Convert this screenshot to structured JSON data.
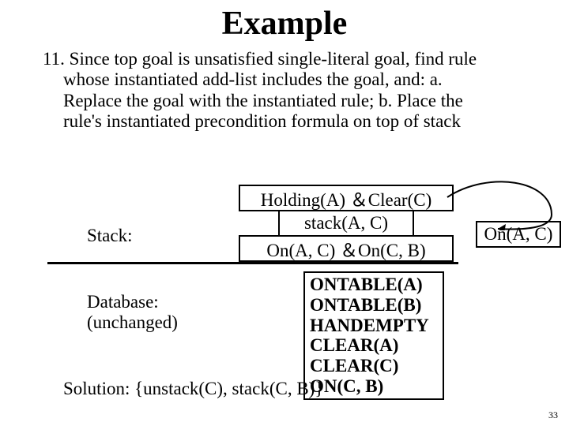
{
  "title": "Example",
  "body": "11. Since top goal is unsatisfied single-literal goal, find rule whose instantiated add-list includes the goal, and:  a. Replace the goal with the instantiated rule; b. Place the rule's instantiated precondition formula on top of stack",
  "stack": {
    "label": "Stack:",
    "top": "Holding(A) ＆Clear(C)",
    "mid": "stack(A, C)",
    "bot": "On(A, C) ＆On(C, B)"
  },
  "side_box": "On(A, C)",
  "database": {
    "label_line1": "Database:",
    "label_line2": "(unchanged)",
    "items": [
      "ONTABLE(A)",
      "ONTABLE(B)",
      "HANDEMPTY",
      "CLEAR(A)",
      "CLEAR(C)",
      "ON(C, B)"
    ]
  },
  "solution": "Solution: {unstack(C), stack(C, B)}",
  "page_number": "33"
}
